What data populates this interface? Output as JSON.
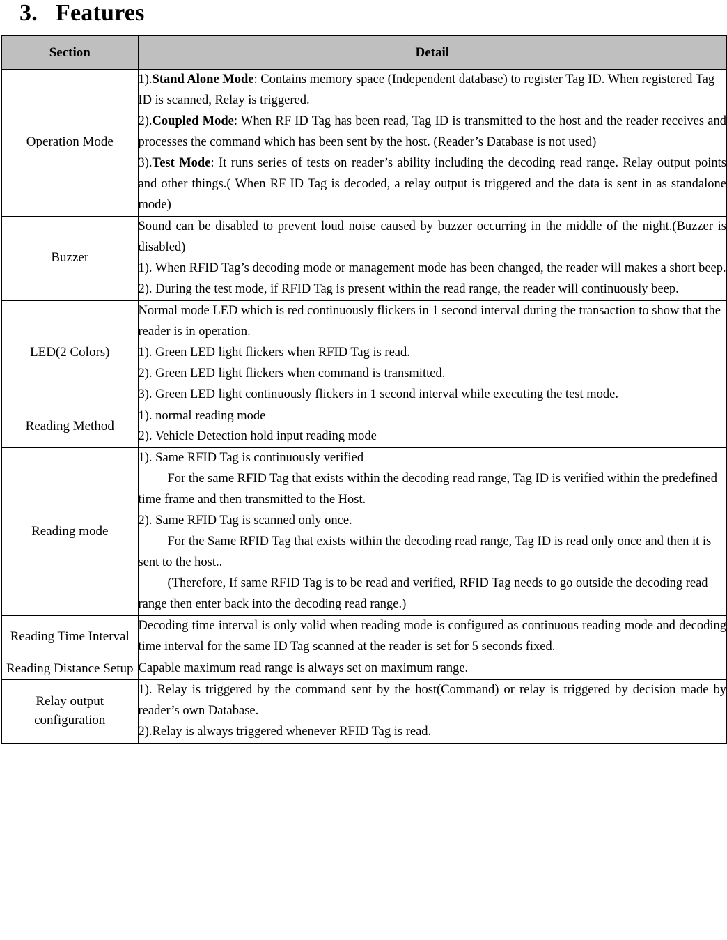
{
  "document": {
    "heading_number": "3.",
    "heading_text": "Features"
  },
  "table": {
    "headers": {
      "section": "Section",
      "detail": "Detail"
    },
    "header_background": "#bfbfbf",
    "rows": [
      {
        "section": "Operation Mode",
        "paragraphs": [
          {
            "index": "1).",
            "bold": "Stand Alone Mode",
            "text": ": Contains memory space (Independent database) to register Tag ID. When registered Tag ID is scanned, Relay is triggered.",
            "indent": false,
            "justify": false
          },
          {
            "index": "2).",
            "bold": "Coupled Mode",
            "text": ": When RF ID Tag has been read, Tag ID is transmitted to the host and the reader receives and processes the command which has been sent by the host. (Reader’s Database is not used)",
            "indent": false,
            "justify": true
          },
          {
            "index": "3).",
            "bold": "Test Mode",
            "text": ":   It runs series of tests on reader’s ability including the decoding read range. Relay output points and other things.( When RF ID Tag is decoded, a relay output is triggered and the data is sent in as standalone mode)",
            "indent": false,
            "justify": true
          }
        ]
      },
      {
        "section": "Buzzer",
        "paragraphs": [
          {
            "index": "",
            "bold": "",
            "text": "Sound can be disabled to prevent loud noise caused by buzzer occurring in the middle of the night.(Buzzer is disabled)",
            "indent": false,
            "justify": true
          },
          {
            "index": "1).",
            "bold": "",
            "text": " When RFID Tag’s decoding mode or management mode has been changed, the reader will makes a short beep.",
            "indent": false,
            "justify": true
          },
          {
            "index": "2).",
            "bold": "",
            "text": " During the test mode, if RFID Tag is present within the read range, the reader will continuously beep.",
            "indent": false,
            "justify": true
          }
        ]
      },
      {
        "section": "LED(2 Colors)",
        "paragraphs": [
          {
            "index": "",
            "bold": "",
            "text": "Normal mode LED which is red continuously flickers in 1 second interval during the transaction to show that the reader is in operation.",
            "indent": false,
            "justify": false
          },
          {
            "index": "1).",
            "bold": "",
            "text": " Green LED light flickers when RFID Tag is read.",
            "indent": false,
            "justify": false
          },
          {
            "index": "2).",
            "bold": "",
            "text": " Green LED light flickers when command is transmitted.",
            "indent": false,
            "justify": false
          },
          {
            "index": "3).",
            "bold": "",
            "text": " Green LED light continuously flickers in 1 second interval while executing the test mode.",
            "indent": false,
            "justify": false
          }
        ]
      },
      {
        "section": "Reading Method",
        "paragraphs": [
          {
            "index": "1).",
            "bold": "",
            "text": " normal reading mode",
            "indent": false,
            "justify": false
          },
          {
            "index": "2).",
            "bold": "",
            "text": " Vehicle Detection hold input reading mode",
            "indent": false,
            "justify": false
          }
        ]
      },
      {
        "section": "Reading mode",
        "paragraphs": [
          {
            "index": "1).",
            "bold": "",
            "text": " Same RFID Tag is continuously verified",
            "indent": false,
            "justify": false
          },
          {
            "index": "",
            "bold": "",
            "text": "For the same RFID Tag that exists within the decoding read range, Tag ID is verified within the predefined time frame and then transmitted to the Host.",
            "indent": true,
            "justify": false
          },
          {
            "index": "2).",
            "bold": "",
            "text": " Same RFID Tag is scanned only once.",
            "indent": false,
            "justify": false
          },
          {
            "index": "",
            "bold": "",
            "text": "For the Same RFID Tag that exists within the decoding read range, Tag ID is read only once and then it is sent to the host..",
            "indent": true,
            "justify": false
          },
          {
            "index": "",
            "bold": "",
            "text": "(Therefore, If same RFID Tag is to be read and verified, RFID Tag needs to go outside the decoding read range then enter back into the decoding read range.)",
            "indent": true,
            "justify": false
          }
        ]
      },
      {
        "section": "Reading Time Interval",
        "paragraphs": [
          {
            "index": "",
            "bold": "",
            "text": "Decoding time interval is only valid when reading mode is configured as continuous reading mode and decoding time interval for the same ID Tag scanned at the reader is set for 5 seconds fixed.",
            "indent": false,
            "justify": true
          }
        ]
      },
      {
        "section": "Reading Distance Setup",
        "paragraphs": [
          {
            "index": "",
            "bold": "",
            "text": "Capable maximum read range is always set on maximum range.",
            "indent": false,
            "justify": false
          }
        ]
      },
      {
        "section": "Relay output configuration",
        "paragraphs": [
          {
            "index": "1).",
            "bold": "",
            "text": " Relay is triggered by the command sent by the host(Command) or relay is triggered by decision made by reader’s own Database.",
            "indent": false,
            "justify": true
          },
          {
            "index": "2).",
            "bold": "",
            "text": "Relay is always triggered whenever RFID Tag is read.",
            "indent": false,
            "justify": false
          }
        ]
      }
    ]
  }
}
